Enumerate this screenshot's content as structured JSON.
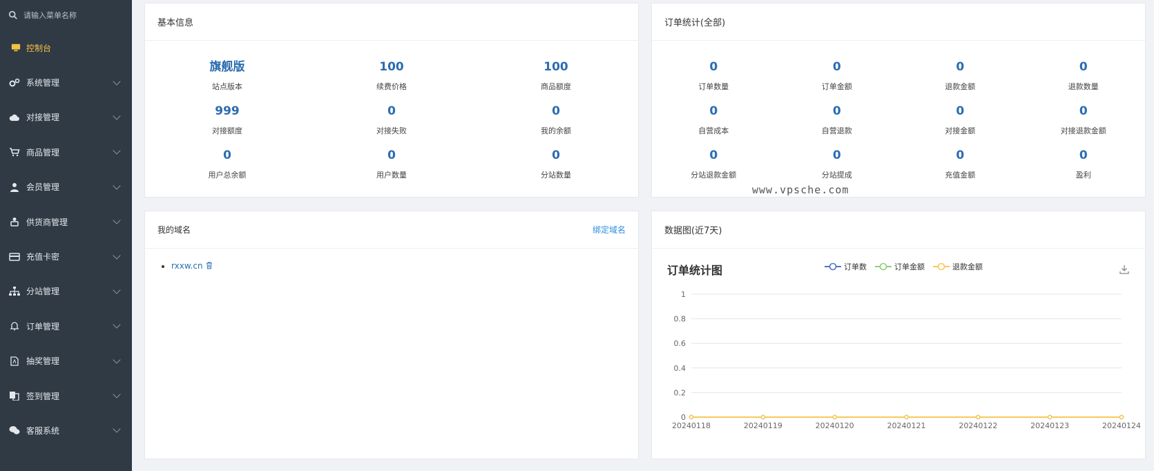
{
  "sidebar": {
    "search_placeholder": "请输入菜单名称",
    "items": [
      {
        "label": "控制台",
        "icon": "monitor-icon",
        "active": true
      },
      {
        "label": "系统管理",
        "icon": "gears-icon"
      },
      {
        "label": "对接管理",
        "icon": "cloud-icon"
      },
      {
        "label": "商品管理",
        "icon": "cart-icon"
      },
      {
        "label": "会员管理",
        "icon": "user-icon"
      },
      {
        "label": "供货商管理",
        "icon": "supplier-icon"
      },
      {
        "label": "充值卡密",
        "icon": "card-icon"
      },
      {
        "label": "分站管理",
        "icon": "sitemap-icon"
      },
      {
        "label": "订单管理",
        "icon": "bell-icon"
      },
      {
        "label": "抽奖管理",
        "icon": "file-icon"
      },
      {
        "label": "签到管理",
        "icon": "copy-icon"
      },
      {
        "label": "客服系统",
        "icon": "wechat-icon"
      }
    ]
  },
  "basic_info": {
    "title": "基本信息",
    "stats": [
      {
        "value": "旗舰版",
        "label": "站点版本"
      },
      {
        "value": "100",
        "label": "续费价格"
      },
      {
        "value": "100",
        "label": "商品额度"
      },
      {
        "value": "999",
        "label": "对接额度"
      },
      {
        "value": "0",
        "label": "对接失败"
      },
      {
        "value": "0",
        "label": "我的余额"
      },
      {
        "value": "0",
        "label": "用户总余额"
      },
      {
        "value": "0",
        "label": "用户数量"
      },
      {
        "value": "0",
        "label": "分站数量"
      }
    ]
  },
  "order_stats": {
    "title": "订单统计(全部)",
    "stats": [
      {
        "value": "0",
        "label": "订单数量"
      },
      {
        "value": "0",
        "label": "订单金额"
      },
      {
        "value": "0",
        "label": "退款金额"
      },
      {
        "value": "0",
        "label": "退款数量"
      },
      {
        "value": "0",
        "label": "自营成本"
      },
      {
        "value": "0",
        "label": "自营退款"
      },
      {
        "value": "0",
        "label": "对接金额"
      },
      {
        "value": "0",
        "label": "对接退款金额"
      },
      {
        "value": "0",
        "label": "分站退款金额"
      },
      {
        "value": "0",
        "label": "分站提成"
      },
      {
        "value": "0",
        "label": "充值金额"
      },
      {
        "value": "0",
        "label": "盈利"
      }
    ]
  },
  "domains": {
    "title": "我的域名",
    "bind_label": "绑定域名",
    "items": [
      "rxxw.cn"
    ]
  },
  "watermark": "www.vpsche.com",
  "chart_panel": {
    "title": "数据图(近7天)"
  },
  "chart_data": {
    "type": "line",
    "title": "订单统计图",
    "x": [
      "20240118",
      "20240119",
      "20240120",
      "20240121",
      "20240122",
      "20240123",
      "20240124"
    ],
    "series": [
      {
        "name": "订单数",
        "color": "#5470c6",
        "values": [
          0,
          0,
          0,
          0,
          0,
          0,
          0
        ]
      },
      {
        "name": "订单金额",
        "color": "#91cc75",
        "values": [
          0,
          0,
          0,
          0,
          0,
          0,
          0
        ]
      },
      {
        "name": "退款金额",
        "color": "#fac858",
        "values": [
          0,
          0,
          0,
          0,
          0,
          0,
          0
        ]
      }
    ],
    "yticks": [
      "0",
      "0.2",
      "0.4",
      "0.6",
      "0.8",
      "1"
    ],
    "ylim": [
      0,
      1
    ],
    "grid": true,
    "legend": "top"
  }
}
